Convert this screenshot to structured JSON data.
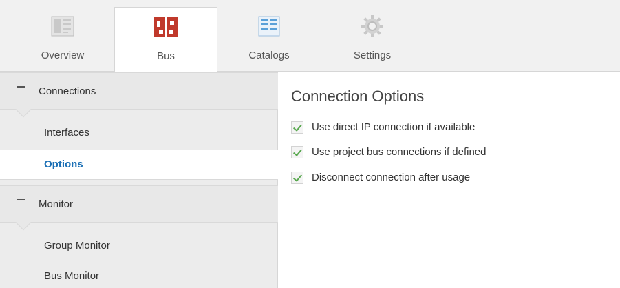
{
  "tabs": [
    {
      "label": "Overview",
      "icon": "overview-icon"
    },
    {
      "label": "Bus",
      "icon": "bus-icon",
      "active": true
    },
    {
      "label": "Catalogs",
      "icon": "catalogs-icon"
    },
    {
      "label": "Settings",
      "icon": "gear-icon"
    }
  ],
  "sidebar": {
    "groups": [
      {
        "title": "Connections",
        "items": [
          {
            "label": "Interfaces"
          },
          {
            "label": "Options",
            "selected": true
          }
        ]
      },
      {
        "title": "Monitor",
        "items": [
          {
            "label": "Group Monitor"
          },
          {
            "label": "Bus Monitor"
          }
        ]
      }
    ]
  },
  "main": {
    "title": "Connection Options",
    "options": [
      {
        "label": "Use direct IP connection if available",
        "checked": true
      },
      {
        "label": "Use project bus connections if defined",
        "checked": true
      },
      {
        "label": "Disconnect connection after usage",
        "checked": true
      }
    ]
  },
  "colors": {
    "accent": "#1a6fb5",
    "check": "#59a84f",
    "bus_icon": "#c0392b"
  }
}
